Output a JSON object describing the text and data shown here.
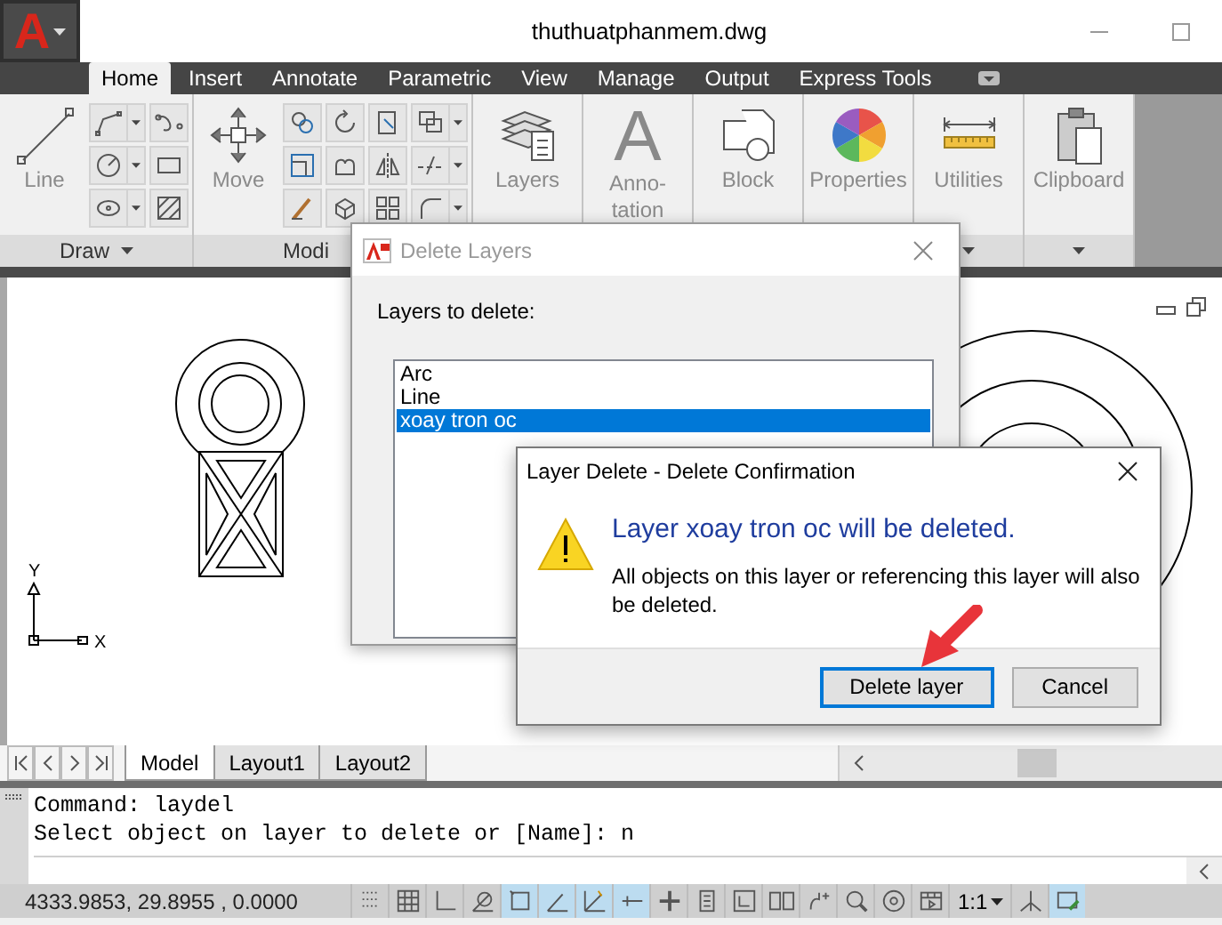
{
  "window": {
    "title": "thuthuatphanmem.dwg"
  },
  "app_button": {
    "glyph": "A"
  },
  "ribbon": {
    "tabs": [
      {
        "label": "Home",
        "selected": true
      },
      {
        "label": "Insert",
        "selected": false
      },
      {
        "label": "Annotate",
        "selected": false
      },
      {
        "label": "Parametric",
        "selected": false
      },
      {
        "label": "View",
        "selected": false
      },
      {
        "label": "Manage",
        "selected": false
      },
      {
        "label": "Output",
        "selected": false
      },
      {
        "label": "Express Tools",
        "selected": false
      }
    ],
    "panels": [
      {
        "kind": "draw_tools",
        "tool": "Line",
        "title": "Draw",
        "expandable": true
      },
      {
        "kind": "modify_tools",
        "tool": "Move",
        "title": "Modi",
        "expandable": false
      },
      {
        "kind": "layers",
        "tool": "Layers"
      },
      {
        "kind": "annotation",
        "tool": "Anno-\ntation",
        "glyph": "A"
      },
      {
        "kind": "block",
        "tool": "Block"
      },
      {
        "kind": "properties",
        "tool": "Properties"
      },
      {
        "kind": "utilities",
        "tool": "Utilities",
        "expandable": true
      },
      {
        "kind": "clipboard",
        "tool": "Clipboard",
        "expandable": true
      }
    ]
  },
  "drawing": {
    "ucs": {
      "x": "X",
      "y": "Y"
    }
  },
  "layout_tabs": [
    {
      "label": "Model",
      "selected": true
    },
    {
      "label": "Layout1",
      "selected": false
    },
    {
      "label": "Layout2",
      "selected": false
    }
  ],
  "command_line": {
    "history": [
      "Command: laydel",
      "Select object on layer to delete or [Name]: n"
    ]
  },
  "status_bar": {
    "coordinates": "4333.9853, 29.8955 , 0.0000",
    "items": [
      {
        "kind": "toggle",
        "on": false
      },
      {
        "kind": "toggle",
        "on": false
      },
      {
        "kind": "toggle",
        "on": false
      },
      {
        "kind": "toggle",
        "on": false
      },
      {
        "kind": "toggle",
        "on": true
      },
      {
        "kind": "toggle",
        "on": true
      },
      {
        "kind": "toggle",
        "on": true
      },
      {
        "kind": "toggle",
        "on": true
      },
      {
        "kind": "toggle",
        "on": false
      },
      {
        "kind": "toggle",
        "on": false
      },
      {
        "kind": "toggle",
        "on": false
      },
      {
        "kind": "toggle",
        "on": false
      },
      {
        "kind": "toggle",
        "on": false
      },
      {
        "kind": "toggle",
        "on": false
      },
      {
        "kind": "toggle",
        "on": false
      },
      {
        "kind": "toggle",
        "on": false
      },
      {
        "kind": "scale",
        "label": "1:1"
      },
      {
        "kind": "toggle",
        "on": false
      },
      {
        "kind": "toggle",
        "on": true
      }
    ]
  },
  "delete_layers_dialog": {
    "title": "Delete Layers",
    "label": "Layers to delete:",
    "layers": [
      {
        "name": "Arc",
        "selected": false
      },
      {
        "name": "Line",
        "selected": false
      },
      {
        "name": "xoay tron oc",
        "selected": true
      }
    ]
  },
  "confirmation_dialog": {
    "title": "Layer Delete - Delete Confirmation",
    "heading": "Layer xoay tron oc will be deleted.",
    "message": "All objects on this layer or referencing this layer will also be deleted.",
    "buttons": [
      {
        "label": "Delete layer",
        "default": true
      },
      {
        "label": "Cancel",
        "default": false
      }
    ]
  }
}
